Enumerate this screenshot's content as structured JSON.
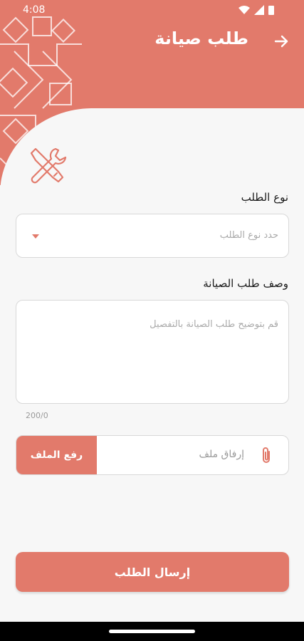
{
  "status_bar": {
    "time": "4:08"
  },
  "header": {
    "title": "طلب صيانة",
    "accent_color": "#E27A6B"
  },
  "form": {
    "type_label": "نوع الطلب",
    "type_placeholder": "حدد نوع الطلب",
    "description_label": "وصف طلب الصيانة",
    "description_placeholder": "قم بتوضيح طلب الصيانة بالتفصيل",
    "description_counter": "200/0",
    "attachment_text": "إرفاق ملف",
    "upload_button": "رفع الملف",
    "submit_button": "إرسال الطلب"
  },
  "icons": {
    "back": "arrow-right-icon",
    "tools": "wrench-screwdriver-icon",
    "attach": "paperclip-icon",
    "dropdown": "caret-down-icon"
  }
}
